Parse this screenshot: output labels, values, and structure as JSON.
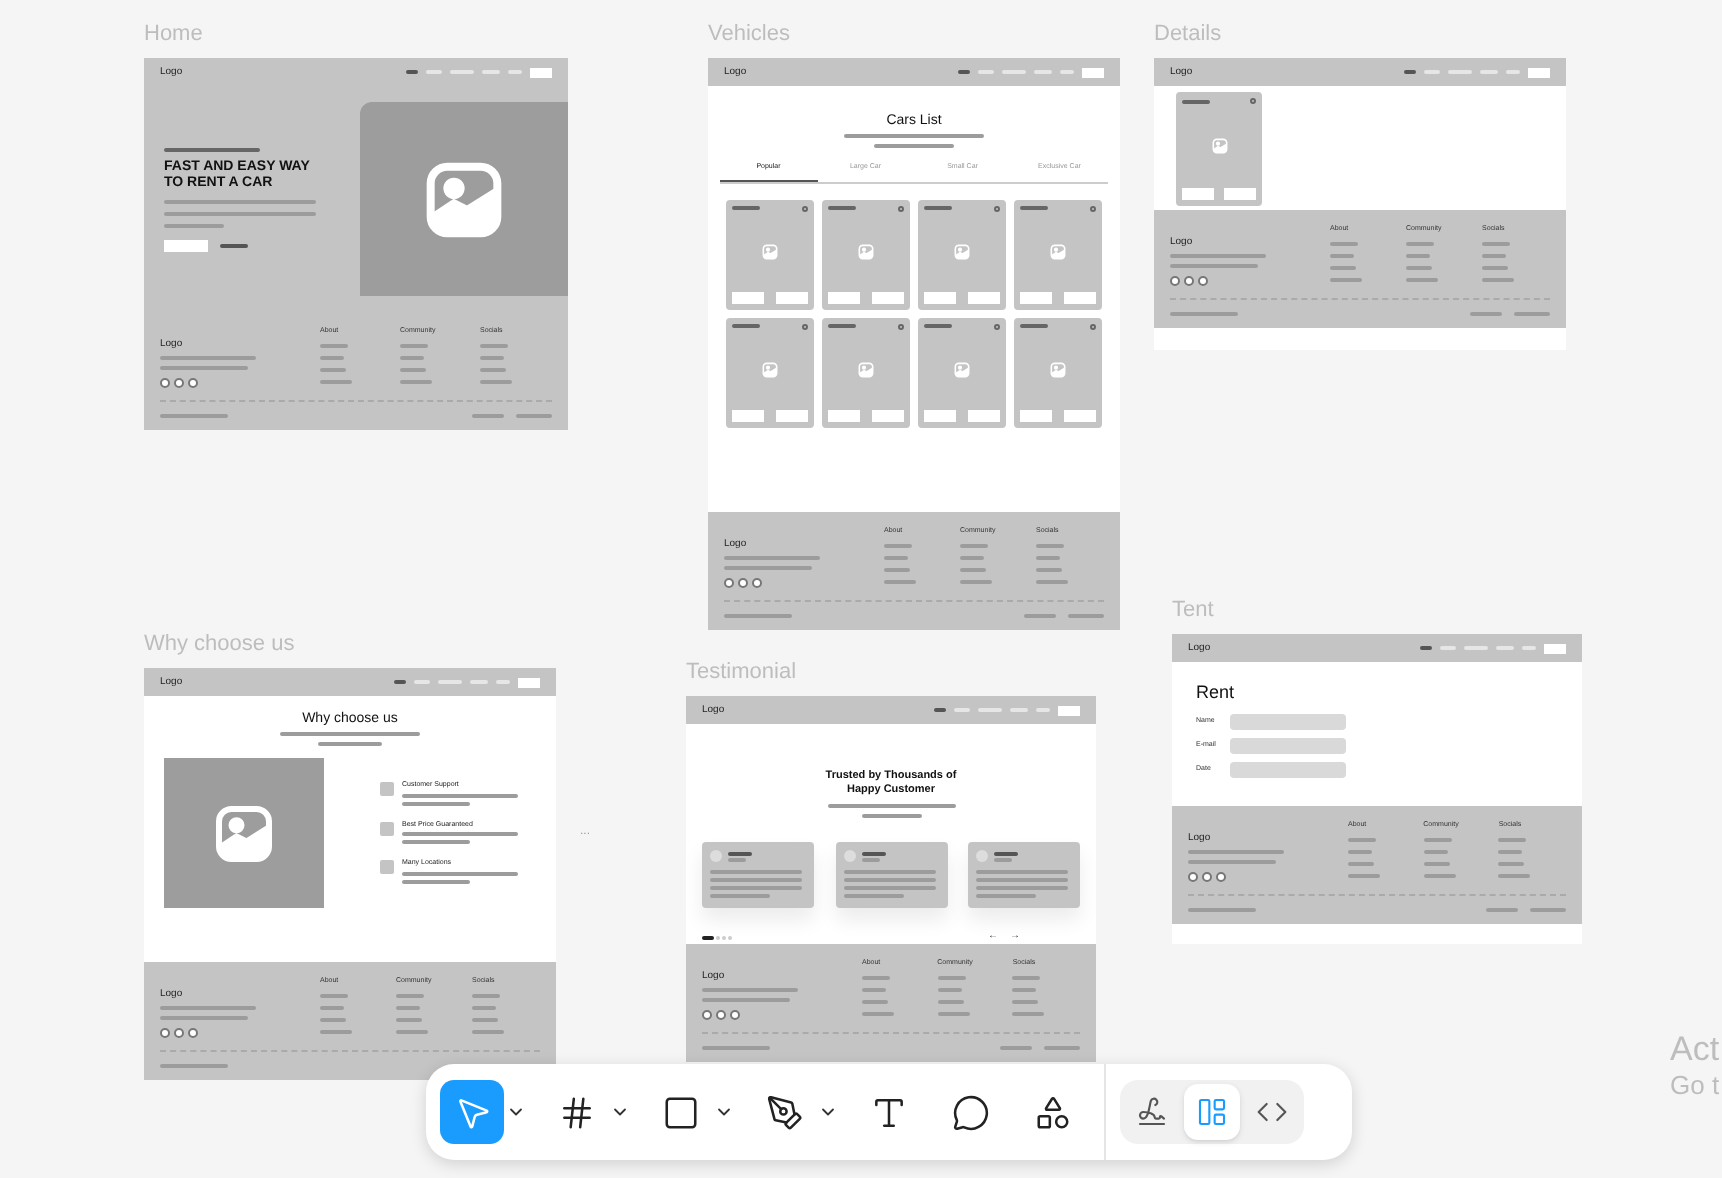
{
  "frames": [
    {
      "kind": "home",
      "title": "Home",
      "logo": "Logo",
      "headline": "FAST AND EASY WAY TO RENT A CAR",
      "footer": {
        "logo": "Logo",
        "headings": [
          "About",
          "Community",
          "Socials"
        ]
      }
    },
    {
      "kind": "vehicles",
      "title": "Vehicles",
      "logo": "Logo",
      "heading": "Cars List",
      "tabs": [
        {
          "label": "Popular",
          "selected": true
        },
        {
          "label": "Large Car",
          "selected": false
        },
        {
          "label": "Small Car",
          "selected": false
        },
        {
          "label": "Exclusive Car",
          "selected": false
        }
      ],
      "footer": {
        "logo": "Logo",
        "headings": [
          "About",
          "Community",
          "Socials"
        ]
      }
    },
    {
      "kind": "details",
      "title": "Details",
      "logo": "Logo",
      "footer": {
        "logo": "Logo",
        "headings": [
          "About",
          "Community",
          "Socials"
        ]
      }
    },
    {
      "kind": "why",
      "title": "Why choose us",
      "logo": "Logo",
      "heading": "Why choose us",
      "features": [
        "Customer Support",
        "Best Price Guaranteed",
        "Many Locations"
      ],
      "footer": {
        "logo": "Logo",
        "headings": [
          "About",
          "Community",
          "Socials"
        ]
      }
    },
    {
      "kind": "testimonial",
      "title": "Testimonial",
      "logo": "Logo",
      "heading": "Trusted by Thousands of Happy Customer",
      "dots": [
        {
          "selected": true
        },
        {
          "selected": false
        },
        {
          "selected": false
        },
        {
          "selected": false
        }
      ],
      "arrows": [
        "←",
        "→"
      ],
      "footer": {
        "logo": "Logo",
        "headings": [
          "About",
          "Community",
          "Socials"
        ]
      }
    },
    {
      "kind": "tent",
      "title": "Tent",
      "logo": "Logo",
      "heading": "Rent",
      "fields": [
        "Name",
        "E-mail",
        "Date"
      ],
      "footer": {
        "logo": "Logo",
        "headings": [
          "About",
          "Community",
          "Socials"
        ]
      }
    }
  ],
  "ellipsis": "...",
  "toolbar": {
    "tools": [
      {
        "kind": "move",
        "selected": true,
        "menu": true
      },
      {
        "kind": "frame",
        "selected": false,
        "menu": true
      },
      {
        "kind": "rectangle",
        "selected": false,
        "menu": true
      },
      {
        "kind": "pen",
        "selected": false,
        "menu": true
      },
      {
        "kind": "text",
        "selected": false,
        "menu": false
      },
      {
        "kind": "comment",
        "selected": false,
        "menu": false
      },
      {
        "kind": "actions",
        "selected": false,
        "menu": false
      }
    ],
    "modes": [
      {
        "kind": "draw",
        "selected": false
      },
      {
        "kind": "design",
        "selected": true
      },
      {
        "kind": "dev",
        "selected": false
      }
    ]
  },
  "os_notice": [
    "Act",
    "Go t"
  ]
}
